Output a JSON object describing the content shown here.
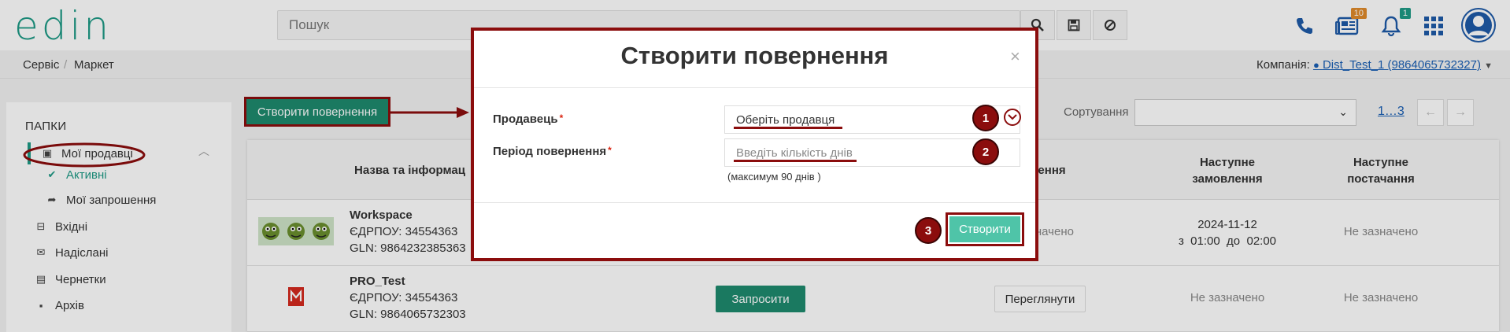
{
  "header": {
    "logo": "edin",
    "search_placeholder": "Пошук",
    "news_badge": "10",
    "notifications_badge": "1"
  },
  "breadcrumb": {
    "items": [
      "Сервіс",
      "Маркет"
    ],
    "company_label": "Компанія:",
    "company_value": "Dist_Test_1 (9864065732327)"
  },
  "sidebar": {
    "title": "ПАПКИ",
    "items": [
      {
        "label": "Мої продавці",
        "icon": "address-book-icon"
      },
      {
        "label": "Активні",
        "icon": "check-icon"
      },
      {
        "label": "Мої запрошення",
        "icon": "share-icon"
      },
      {
        "label": "Вхідні",
        "icon": "inbox-icon"
      },
      {
        "label": "Надіслані",
        "icon": "envelope-icon"
      },
      {
        "label": "Чернетки",
        "icon": "file-icon"
      },
      {
        "label": "Архів",
        "icon": "archive-icon"
      }
    ]
  },
  "toolbar": {
    "create_label": "Створити повернення",
    "sort_label": "Сортування",
    "pager_text": "1…3"
  },
  "table": {
    "headers": {
      "name": "Назва та інформац",
      "returns": "ження",
      "next_order": "Наступне\nзамовлення",
      "next_delivery": "Наступне\nпостачання"
    },
    "rows": [
      {
        "name": "Workspace",
        "edrpou": "ЄДРПОУ: 34554363",
        "gln": "GLN: 9864232385363",
        "returns": "значено",
        "next_order_date": "2024-11-12",
        "next_order_time": "з  01:00  до  02:00",
        "next_delivery": "Не зазначено"
      },
      {
        "name": "PRO_Test",
        "edrpou": "ЄДРПОУ: 34554363",
        "gln": "GLN: 9864065732303",
        "invite_label": "Запросити",
        "view_label": "Переглянути",
        "next_order": "Не зазначено",
        "next_delivery": "Не зазначено"
      }
    ]
  },
  "modal": {
    "title": "Створити повернення",
    "close": "×",
    "seller_label": "Продавець",
    "seller_placeholder": "Оберіть продавця",
    "period_label": "Період повернення",
    "period_placeholder": "Введіть кількість днів",
    "hint": "(максимум 90 днів )",
    "submit_label": "Створити",
    "markers": [
      "1",
      "2",
      "3"
    ]
  },
  "colors": {
    "brand": "#1e9a86",
    "button": "#1e8a6e",
    "annotation": "#8b0d0d",
    "link": "#1a5fb4"
  }
}
